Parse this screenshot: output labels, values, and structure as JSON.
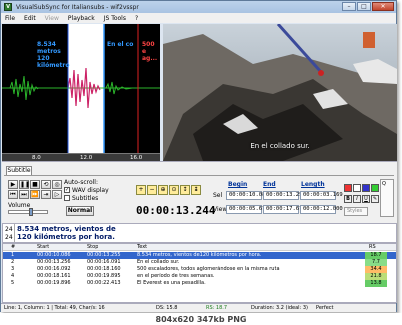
{
  "window": {
    "title": "VisualSubSync for Italiansubs - wif2vsspr"
  },
  "menu": [
    "File",
    "Edit",
    "View",
    "Playback",
    "JS Tools",
    "?"
  ],
  "waveform": {
    "sub_text_1": "8.534 metros\n120 kilómetro",
    "sub_text_2": "En el co",
    "sub_text_3": "500 e\nag...",
    "ruler": [
      "8.0",
      "12.0",
      "16.0"
    ]
  },
  "video": {
    "subtitle": "En el collado sur."
  },
  "toolbar": {
    "subtitle_tab": "Subtitle",
    "autoscroll": "Auto-scroll:",
    "wav_display": "WAV display",
    "subtitles": "Subtitles",
    "volume": "Volume",
    "normal": "Normal",
    "timer": "00:00:13.244",
    "headers": {
      "begin": "Begin",
      "end": "End",
      "length": "Length"
    },
    "sel_label": "Sel",
    "view_label": "View",
    "sel_begin": "00:00:10.086",
    "sel_end": "00:00:13.255",
    "sel_length": "00:00:03.169",
    "view_begin": "00:00:05.670",
    "view_end": "00:00:17.670",
    "view_length": "00:00:12.000",
    "styles": "Styles"
  },
  "editor": {
    "line1_count": "24",
    "line2_count": "24",
    "line1": "8.534 metros, vientos de",
    "line2": "120 kilómetros por hora."
  },
  "table": {
    "headers": [
      "#",
      "Start",
      "Stop",
      "Text",
      "RS"
    ],
    "rows": [
      {
        "n": "1",
        "start": "00:00:10.086",
        "stop": "00:00:13.255",
        "text": "8.534 metros, vientos de120 kilómetros por hora.",
        "rs": "18.7",
        "rs_color": "#66cc66"
      },
      {
        "n": "2",
        "start": "00:00:13.256",
        "stop": "00:00:16.091",
        "text": "En el collado sur.",
        "rs": "7.7",
        "rs_color": "#88dd88"
      },
      {
        "n": "3",
        "start": "00:00:16.092",
        "stop": "00:00:18.160",
        "text": "500 escaladores, todos aglomerándose en la misma ruta",
        "rs": "34.4",
        "rs_color": "#ffbb66"
      },
      {
        "n": "4",
        "start": "00:00:18.161",
        "stop": "00:00:19.895",
        "text": "en el período de tres semanas.",
        "rs": "21.8",
        "rs_color": "#bbdd77"
      },
      {
        "n": "5",
        "start": "00:00:19.896",
        "stop": "00:00:22.413",
        "text": "El Everest es una pesadilla.",
        "rs": "13.8",
        "rs_color": "#66cc66"
      }
    ]
  },
  "status": {
    "pos": "Line: 1, Column: 1 | Total: 49, Char/s: 16",
    "ds": "DS: 15.8",
    "rs": "RS: 18.7",
    "duration": "Duration: 3.2 (ideal: 3)",
    "quality": "Perfect"
  },
  "caption": "804x620 347kb PNG"
}
